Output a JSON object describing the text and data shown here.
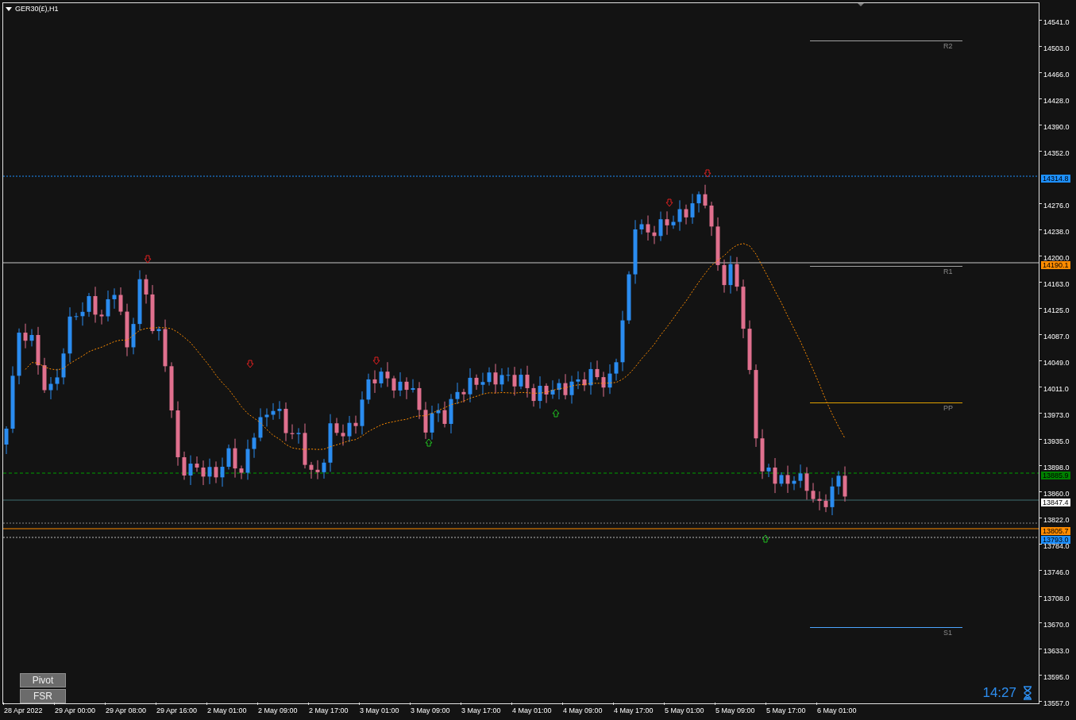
{
  "chart": {
    "title": "GER30(£),H1"
  },
  "price_axis": {
    "ticks": [
      "14541.0",
      "14503.0",
      "14466.0",
      "14428.0",
      "14390.0",
      "14352.0",
      "14276.0",
      "14238.0",
      "14200.0",
      "14163.0",
      "14125.0",
      "14087.0",
      "14049.0",
      "14011.0",
      "13973.0",
      "13935.0",
      "13898.0",
      "13860.0",
      "13822.0",
      "13784.0",
      "13746.0",
      "13708.0",
      "13670.0",
      "13633.0",
      "13595.0",
      "13557.0"
    ]
  },
  "price_tags": [
    {
      "text": "14314.8",
      "color": "#1e90ff"
    },
    {
      "text": "14190.1",
      "color": "#ff8c00"
    },
    {
      "text": "13885.9",
      "color": "#008000"
    },
    {
      "text": "13847.4",
      "color": "#ffffff"
    },
    {
      "text": "13805.7",
      "color": "#ff8c00"
    },
    {
      "text": "13793.0",
      "color": "#1e90ff"
    }
  ],
  "pivot_levels": [
    {
      "label": "R2",
      "color": "#a0a0a0"
    },
    {
      "label": "R1",
      "color": "#a0a0a0"
    },
    {
      "label": "PP",
      "color": "#e0a000"
    },
    {
      "label": "S1",
      "color": "#4da6ff"
    }
  ],
  "time_axis": [
    "28 Apr 2022",
    "29 Apr 00:00",
    "29 Apr 08:00",
    "29 Apr 16:00",
    "2 May 01:00",
    "2 May 09:00",
    "2 May 17:00",
    "3 May 01:00",
    "3 May 09:00",
    "3 May 17:00",
    "4 May 01:00",
    "4 May 09:00",
    "4 May 17:00",
    "5 May 01:00",
    "5 May 09:00",
    "5 May 17:00",
    "6 May 01:00"
  ],
  "buttons": [
    "Pivot",
    "FSR"
  ],
  "timer": "14:27"
}
